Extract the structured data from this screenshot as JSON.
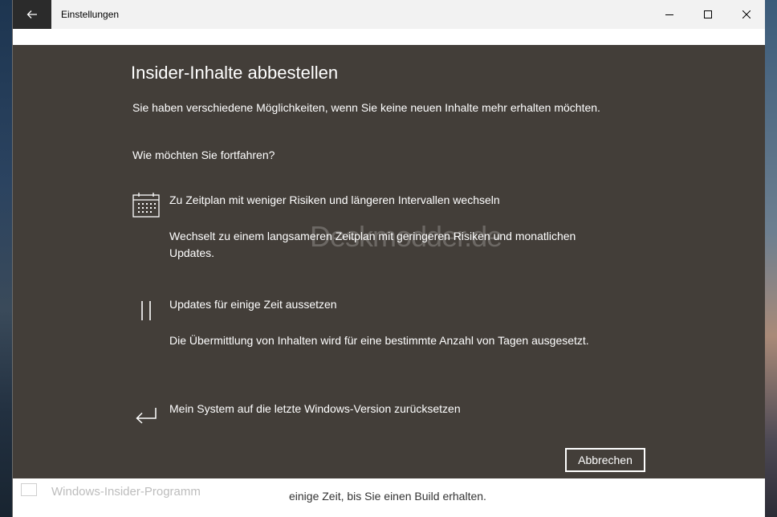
{
  "window": {
    "title": "Einstellungen"
  },
  "background": {
    "item_label": "Windows-Insider-Programm",
    "text": "einige Zeit, bis Sie einen Build erhalten."
  },
  "dialog": {
    "title": "Insider-Inhalte abbestellen",
    "intro": "Sie haben verschiedene Möglichkeiten, wenn Sie keine neuen Inhalte mehr erhalten möchten.",
    "question": "Wie möchten Sie fortfahren?",
    "options": [
      {
        "icon": "calendar-icon",
        "label": "Zu Zeitplan mit weniger Risiken und längeren Intervallen wechseln",
        "description": "Wechselt zu einem langsameren Zeitplan mit geringeren Risiken und monatlichen Updates."
      },
      {
        "icon": "pause-icon",
        "label": "Updates für einige Zeit aussetzen",
        "description": "Die Übermittlung von Inhalten wird für eine bestimmte Anzahl von Tagen ausgesetzt."
      },
      {
        "icon": "return-icon",
        "label": "Mein System auf die letzte Windows-Version zurücksetzen",
        "description": ""
      }
    ],
    "cancel_label": "Abbrechen",
    "watermark": "Deskmodder.de"
  },
  "colors": {
    "dialog_bg": "#433e39",
    "titlebar_bg": "#f2f2f2",
    "back_button_bg": "#2b2b2b"
  }
}
